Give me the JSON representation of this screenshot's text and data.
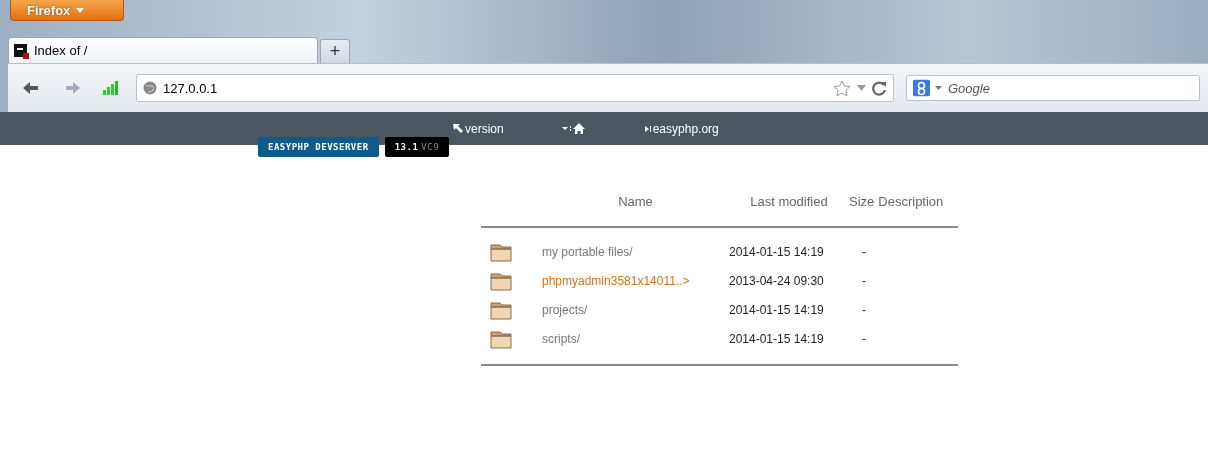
{
  "browser": {
    "menu_button": "Firefox",
    "tab_title": "Index of /",
    "new_tab": "+",
    "address": "127.0.0.1",
    "search": {
      "placeholder": "Google"
    }
  },
  "site_nav": {
    "links": [
      {
        "kind": "version",
        "label": "version"
      },
      {
        "kind": "home"
      },
      {
        "kind": "link",
        "label": "easyphp.org"
      }
    ],
    "badges": [
      {
        "kind": "product",
        "label": "EASYPHP DEVSERVER"
      },
      {
        "kind": "version",
        "label": "13.1",
        "suffix": "VC9"
      }
    ]
  },
  "listing": {
    "columns": [
      "Name",
      "Last modified",
      "Size",
      "Description"
    ],
    "rows": [
      {
        "name": "my portable files/",
        "modified": "2014-01-15 14:19",
        "size": "-",
        "highlighted": false
      },
      {
        "name": "phpmyadmin3581x14011..>",
        "modified": "2013-04-24 09:30",
        "size": "-",
        "highlighted": true
      },
      {
        "name": "projects/",
        "modified": "2014-01-15 14:19",
        "size": "-",
        "highlighted": false
      },
      {
        "name": "scripts/",
        "modified": "2014-01-15 14:19",
        "size": "-",
        "highlighted": false
      }
    ]
  }
}
